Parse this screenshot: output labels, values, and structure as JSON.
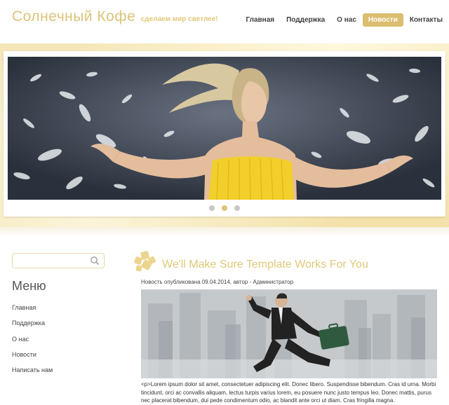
{
  "header": {
    "title": "Солнечный Кофе",
    "slogan": "сделаем мир светлее!",
    "nav": [
      "Главная",
      "Поддержка",
      "О нас",
      "Новости",
      "Контакты"
    ],
    "active_nav": "Новости"
  },
  "slider": {
    "slide_count": 3,
    "active_index": 1
  },
  "sidebar": {
    "search": {
      "value": "",
      "placeholder": ""
    },
    "menu_title": "Меню",
    "menu_items": [
      "Главная",
      "Поддержка",
      "О нас",
      "Новости",
      "Написать нам"
    ]
  },
  "post": {
    "title": "We'll Make Sure Template Works For You",
    "meta": "Новость опубликована 09.04.2014, автор - Администратор",
    "body": "<p>Lorem ipsum dolor sit amet, consectetuer adipiscing elit. Donec libero. Suspendisse bibendum. Cras id urna. Morbi tincidunt, orci ac convallis aliquam, lectus turpis varius lorem, eu posuere nunc justo tempus leo. Donec mattis, purus nec placerat bibendum, dui pede condimentum odio, ac blandit ante orci ut diam. Cras fringilla magna."
  },
  "colors": {
    "accent": "#dcc37a",
    "nav_active_bg": "#dbbd6f",
    "text": "#444444"
  }
}
